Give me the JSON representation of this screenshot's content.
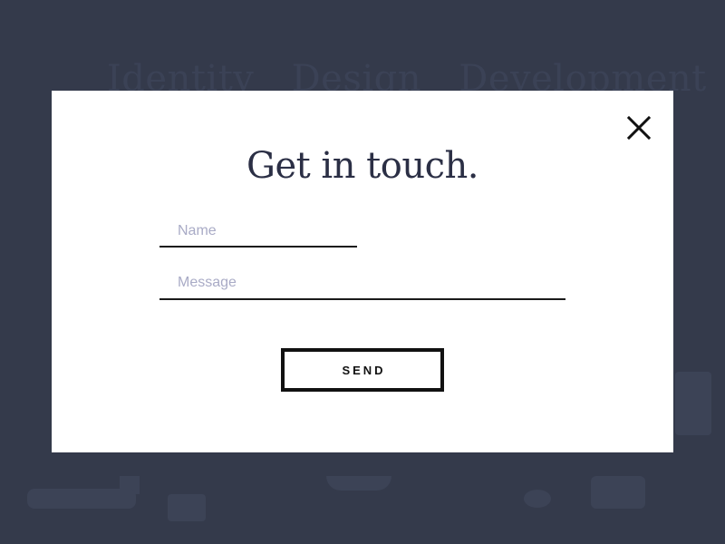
{
  "colors": {
    "backdrop": "#343a4b",
    "backdrop_text": "#3b4256",
    "backdrop_shape": "#3c4356",
    "modal_bg": "#ffffff",
    "title": "#2b2f45",
    "underline": "#1a1a1a",
    "placeholder": "#a9abc6",
    "button_border": "#111111",
    "button_text": "#111111",
    "close_icon": "#111111"
  },
  "background": {
    "nav_items": [
      "Identity",
      "Design",
      "Development"
    ]
  },
  "modal": {
    "title": "Get in touch.",
    "close_icon": "close-icon",
    "name_placeholder": "Name",
    "message_placeholder": "Message",
    "send_label": "SEND"
  }
}
